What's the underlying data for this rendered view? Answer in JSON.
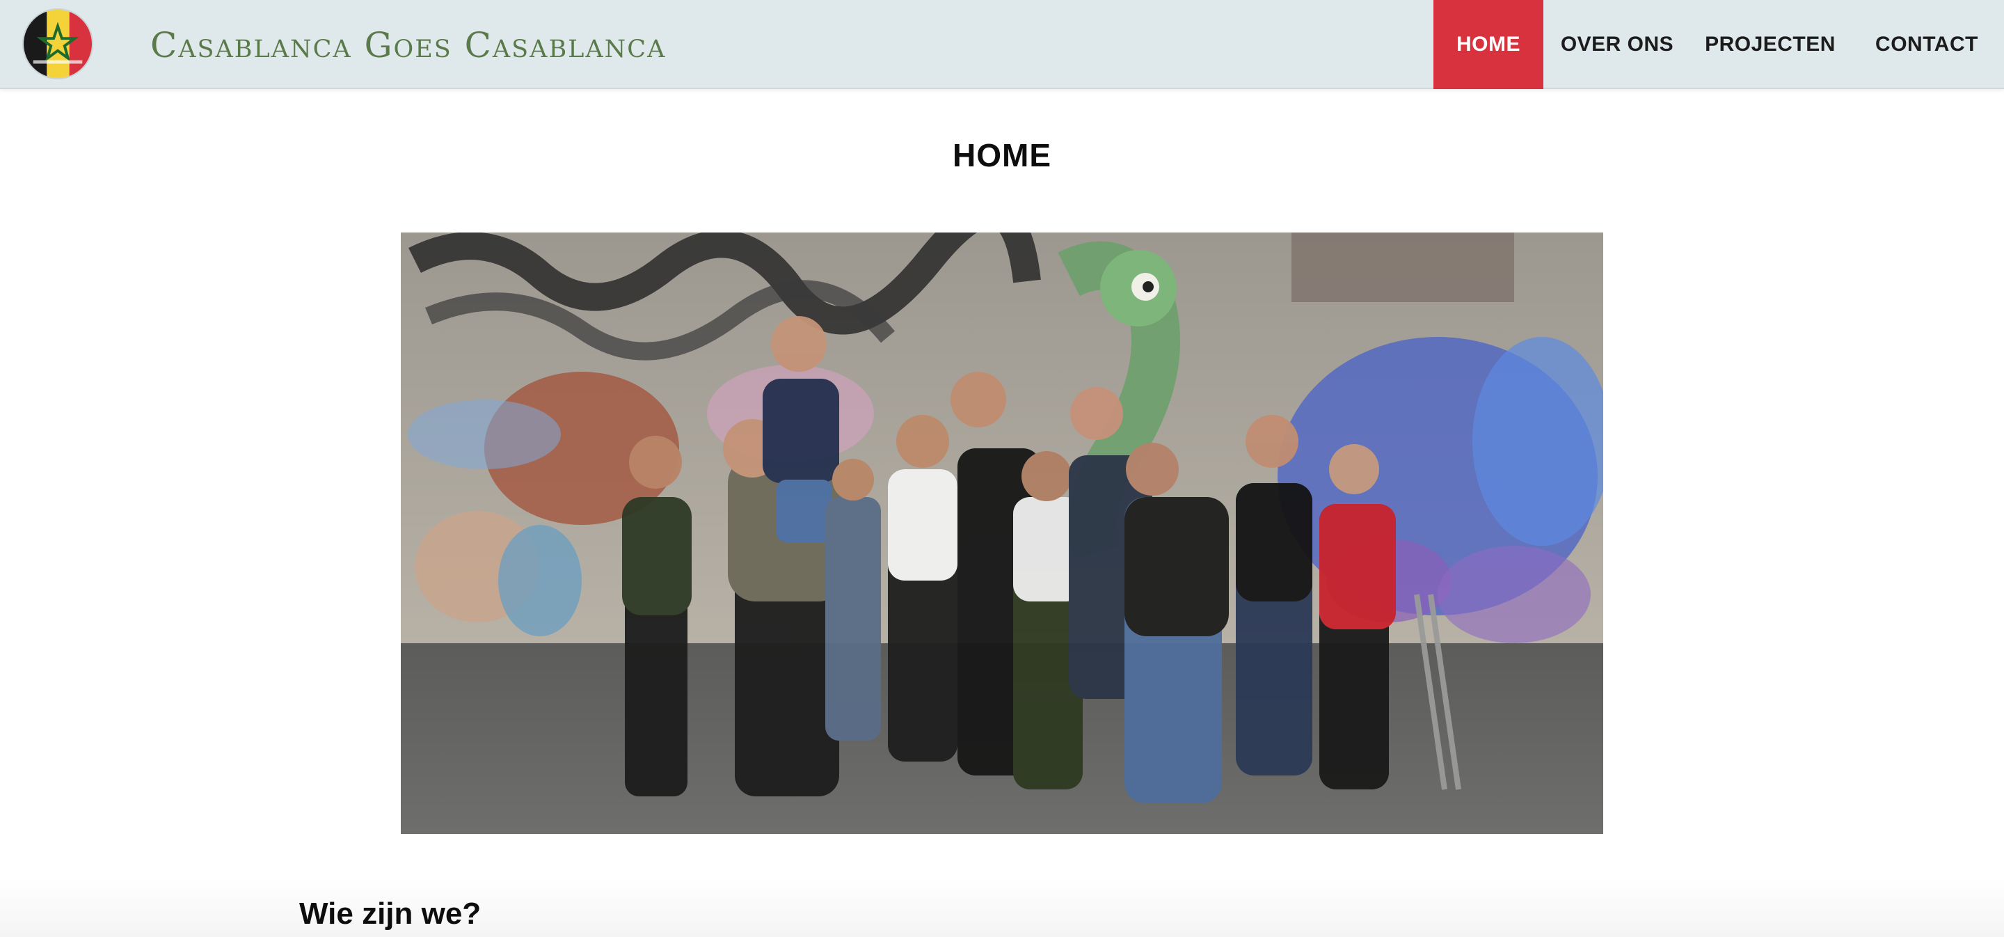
{
  "header": {
    "site_title": "Casablanca Goes Casablanca",
    "logo_icon": "flag-emblem-icon"
  },
  "nav": {
    "items": [
      {
        "label": "HOME",
        "active": true
      },
      {
        "label": "OVER ONS",
        "active": false
      },
      {
        "label": "PROJECTEN",
        "active": false
      },
      {
        "label": "CONTACT",
        "active": false
      }
    ]
  },
  "main": {
    "page_title": "HOME",
    "section_heading": "Wie zijn we?"
  },
  "colors": {
    "header_bg": "#dfe8ea",
    "accent": "#d9323f",
    "title_green": "#5a7a4a"
  }
}
